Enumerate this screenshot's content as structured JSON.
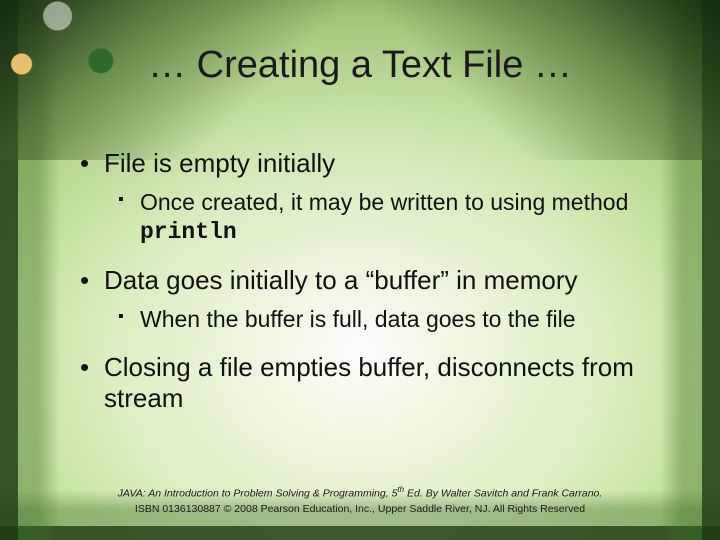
{
  "title": "… Creating a Text File …",
  "bullets": {
    "b1": "File is empty initially",
    "b1_sub_prefix": "Once created, it  may be written to using method ",
    "b1_sub_code": "println",
    "b2": "Data goes initially to a “buffer” in memory",
    "b2_sub": "When the buffer is full, data goes to the file",
    "b3": "Closing a file empties buffer, disconnects from stream"
  },
  "footer": {
    "line1_a": "JAVA: An Introduction to Problem Solving & Programming, 5",
    "line1_sup": "th",
    "line1_b": " Ed. By Walter Savitch and Frank Carrano.",
    "line2": "ISBN 0136130887 © 2008 Pearson Education, Inc., Upper Saddle River, NJ. All Rights Reserved"
  }
}
